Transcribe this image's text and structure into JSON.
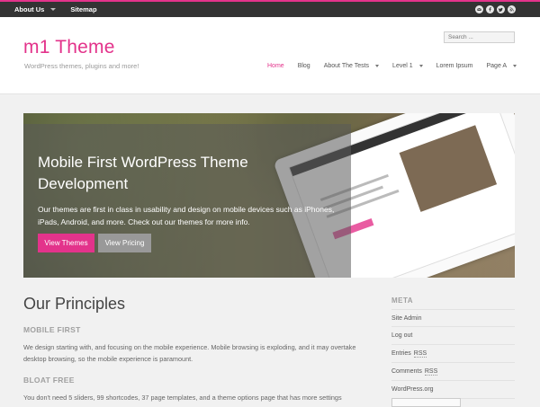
{
  "topbar": {
    "nav": [
      {
        "label": "About Us",
        "has_dropdown": true
      },
      {
        "label": "Sitemap",
        "has_dropdown": false
      }
    ],
    "social_icons": [
      "email-icon",
      "facebook-icon",
      "twitter-icon",
      "rss-icon"
    ],
    "accent": "#e3338b"
  },
  "header": {
    "site_title": "m1 Theme",
    "tagline": "WordPress themes, plugins and more!",
    "search_placeholder": "Search ...",
    "nav": [
      {
        "label": "Home",
        "active": true,
        "has_dropdown": false
      },
      {
        "label": "Blog",
        "active": false,
        "has_dropdown": false
      },
      {
        "label": "About The Tests",
        "active": false,
        "has_dropdown": true
      },
      {
        "label": "Level 1",
        "active": false,
        "has_dropdown": true
      },
      {
        "label": "Lorem Ipsum",
        "active": false,
        "has_dropdown": false
      },
      {
        "label": "Page A",
        "active": false,
        "has_dropdown": true
      }
    ]
  },
  "hero": {
    "title": "Mobile First WordPress Theme Development",
    "text": "Our themes are first in class in usability and design on mobile devices such as iPhones, iPads, Android, and more. Check out our themes for more info.",
    "primary_button": "View Themes",
    "secondary_button": "View Pricing"
  },
  "main": {
    "title": "Our Principles",
    "sections": [
      {
        "heading": "MOBILE FIRST",
        "text": "We design starting with, and focusing on the mobile experience. Mobile browsing is exploding, and it may overtake desktop browsing, so the mobile experience is paramount."
      },
      {
        "heading": "BLOAT FREE",
        "text": "You don't need 5 sliders, 99 shortcodes, 37 page templates, and a theme options page that has more settings"
      }
    ]
  },
  "sidebar": {
    "title": "META",
    "items": [
      {
        "label": "Site Admin"
      },
      {
        "label": "Log out"
      },
      {
        "label": "Entries",
        "abbr": "RSS"
      },
      {
        "label": "Comments",
        "abbr": "RSS"
      },
      {
        "label": "WordPress.org"
      }
    ]
  }
}
